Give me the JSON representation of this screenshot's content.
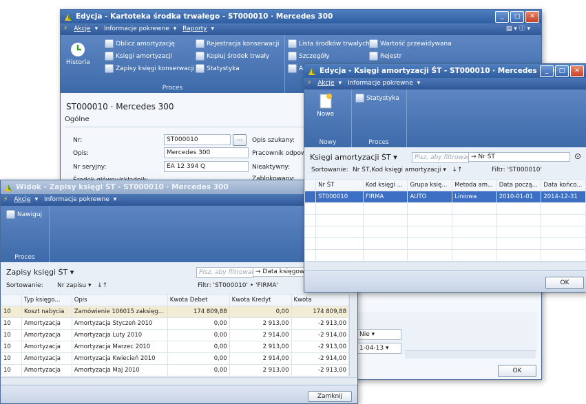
{
  "main_window": {
    "title": "Edycja - Kartoteka środka trwałego - ST000010 · Mercedes 300",
    "menu": [
      "Akcje",
      "Informacje pokrewne",
      "Raporty"
    ],
    "ribbon": {
      "history": "Historia",
      "col1": [
        "Oblicz amortyzację",
        "Księgi amortyzacji",
        "Zapisy księgi konserwacji"
      ],
      "col2": [
        "Rejestracja konserwacji",
        "Kopiuj środek trwały",
        "Statystyka"
      ],
      "col3": [
        "Lista środków trwałych",
        "Szczegóły",
        "An"
      ],
      "col4": [
        "Wartość przewidywana",
        "Rejestr"
      ],
      "group_label": "Proces"
    },
    "header": "ST000010 · Mercedes 300",
    "section": "Ogólne",
    "fields": {
      "nr_label": "Nr:",
      "nr_value": "ST000010",
      "ellipsis": "...",
      "opis_label": "Opis:",
      "opis_value": "Mercedes 300",
      "seryjny_label": "Nr seryjny:",
      "seryjny_value": "EA 12 394 Q",
      "skladnik_label": "Środek główny/składnik:",
      "opis_szukany": "Opis szukany:",
      "pracownik": "Pracownik odpowie",
      "nieaktywny": "Nieaktywny:",
      "zablokowany": "Zablokowany:"
    },
    "right_fields": {
      "nie": "Nie",
      "date": "1-04-13"
    },
    "ok": "OK"
  },
  "ledger_window": {
    "title": "Widok - Zapisy księgi ŚT - ST000010 · Mercedes 300",
    "menu": [
      "Akcje",
      "Informacje pokrewne"
    ],
    "ribbon": {
      "navigate": "Nawiguj",
      "group_label": "Proces"
    },
    "list_title": "Zapisy księgi ŚT",
    "filter_placeholder": "Pisz, aby filtrować",
    "filter_field": "Data księgowa",
    "sort_label": "Sortowanie:",
    "sort_value": "Nr zapisu",
    "filter_text": "Filtr: 'ST000010' • 'FIRMA'",
    "columns": [
      "",
      "Typ księgo...",
      "Opis",
      "Kwota Debet",
      "Kwota Kredyt",
      "Kwota"
    ],
    "rows": [
      [
        "10",
        "Koszt nabycia",
        "Zamówienie 106015 zaksięgo...",
        "174 809,88",
        "0,00",
        "174 809,88"
      ],
      [
        "10",
        "Amortyzacja",
        "Amortyzacja Styczeń 2010",
        "0,00",
        "2 913,00",
        "-2 913,00"
      ],
      [
        "10",
        "Amortyzacja",
        "Amortyzacja Luty 2010",
        "0,00",
        "2 914,00",
        "-2 914,00"
      ],
      [
        "10",
        "Amortyzacja",
        "Amortyzacja Marzec 2010",
        "0,00",
        "2 913,00",
        "-2 913,00"
      ],
      [
        "10",
        "Amortyzacja",
        "Amortyzacja Kwiecień 2010",
        "0,00",
        "2 914,00",
        "-2 914,00"
      ],
      [
        "10",
        "Amortyzacja",
        "Amortyzacja Maj 2010",
        "0,00",
        "2 913,00",
        "-2 913,00"
      ]
    ],
    "close": "Zamknij"
  },
  "books_window": {
    "title": "Edycja - Księgi amortyzacji ŚT - ST000010 · Mercedes 300",
    "menu": [
      "Akcje",
      "Informacje pokrewne"
    ],
    "ribbon": {
      "new": "Nowe",
      "stats": "Statystyka",
      "group_new": "Nowy",
      "group_proc": "Proces"
    },
    "list_title": "Księgi amortyzacji ŚT",
    "filter_placeholder": "Pisz, aby filtrować",
    "filter_field": "Nr ŚT",
    "sort_label": "Sortowanie:",
    "sort_value": "Nr ŚT,Kod księgi amortyzacji",
    "filter_text": "Filtr: 'ST000010'",
    "columns": [
      "Nr ŚT",
      "Kod księgi ...",
      "Grupa księ...",
      "Metoda am...",
      "Data począ...",
      "Data końco..."
    ],
    "rows": [
      [
        "ST000010",
        "FIRMA",
        "AUTO",
        "Liniowa",
        "2010-01-01",
        "2014-12-31"
      ]
    ],
    "ok": "OK"
  },
  "colors": {
    "accent": "#2f5ea1",
    "selected_row": "#3c6fc4",
    "ledger_selected": "#f3ecd5"
  }
}
